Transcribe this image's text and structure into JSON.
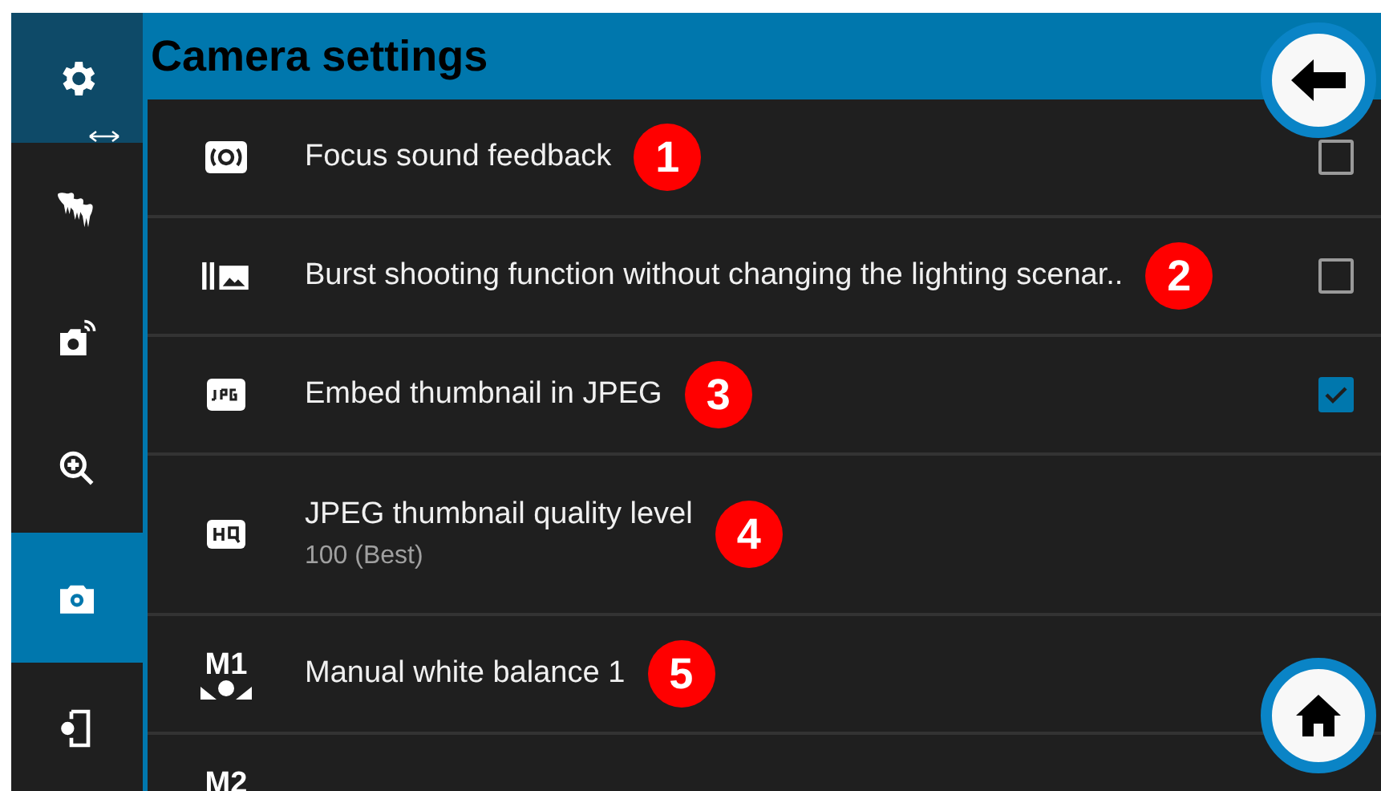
{
  "sidebar": {
    "items": [
      {
        "kind": "section",
        "selected": false
      },
      {
        "kind": "nav",
        "selected": false
      },
      {
        "kind": "nav",
        "selected": false
      },
      {
        "kind": "nav",
        "selected": false
      },
      {
        "kind": "nav",
        "selected": true
      },
      {
        "kind": "nav",
        "selected": false
      }
    ]
  },
  "header": {
    "title": "Camera settings"
  },
  "settings": [
    {
      "kind": "checkbox",
      "label": "Focus sound feedback",
      "marker": "1",
      "checked": false
    },
    {
      "kind": "checkbox",
      "label": "Burst shooting function without changing the lighting scenar..",
      "marker": "2",
      "checked": false
    },
    {
      "kind": "checkbox",
      "label": "Embed thumbnail in JPEG",
      "marker": "3",
      "checked": true
    },
    {
      "kind": "value",
      "label": "JPEG thumbnail quality level",
      "value": "100 (Best)",
      "marker": "4"
    },
    {
      "kind": "action",
      "icon_text": "M1",
      "label": "Manual white balance 1",
      "marker": "5"
    },
    {
      "kind": "action",
      "icon_text": "M2"
    }
  ]
}
